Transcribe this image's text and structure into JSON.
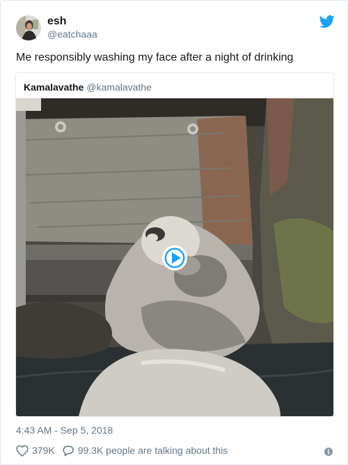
{
  "tweet": {
    "author_name": "esh",
    "author_handle": "@eatchaaa",
    "text": "Me responsibly washing my face after a night of drinking",
    "timestamp": "4:43 AM - Sep 5, 2018",
    "likes": "379K",
    "talking": "99.3K people are talking about this"
  },
  "quoted": {
    "author_name": "Kamalavathe",
    "author_handle": "@kamalavathe"
  },
  "colors": {
    "brand": "#1da1f2",
    "text": "#14171a",
    "muted": "#657786",
    "border": "#e1e8ed"
  },
  "icons": {
    "logo": "twitter-bird-icon",
    "play": "play-icon",
    "like": "heart-icon",
    "reply": "speech-bubble-icon",
    "info": "info-icon"
  }
}
